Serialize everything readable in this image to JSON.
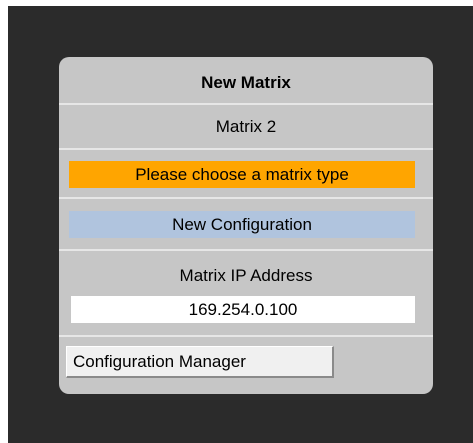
{
  "panel": {
    "title": "New Matrix",
    "matrix_name": "Matrix 2",
    "warning": "Please choose a matrix type",
    "new_configuration_label": "New Configuration",
    "ip_label": "Matrix IP Address",
    "ip_value": "169.254.0.100",
    "config_manager_label": "Configuration Manager"
  },
  "colors": {
    "backdrop": "#2b2b2b",
    "panel": "#c6c6c6",
    "warning": "#ffa500",
    "new_configuration": "#b0c4de"
  }
}
